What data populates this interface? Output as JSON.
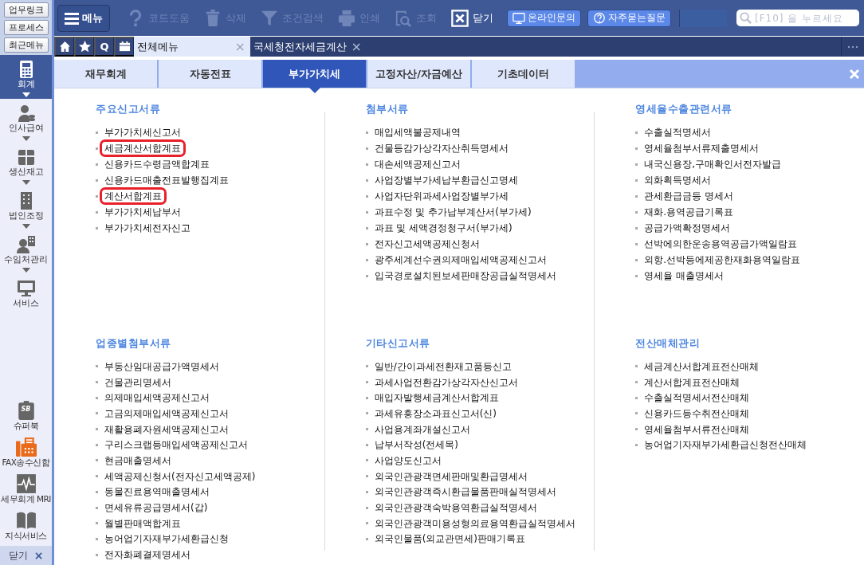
{
  "side_panel": {
    "quick_buttons": [
      "업무링크",
      "프로세스",
      "최근메뉴"
    ],
    "modules": [
      {
        "label": "회계",
        "selected": true,
        "caret": true
      },
      {
        "label": "인사급여",
        "selected": false,
        "caret": true
      },
      {
        "label": "생산재고",
        "selected": false,
        "caret": true
      },
      {
        "label": "법인조정",
        "selected": false,
        "caret": true
      },
      {
        "label": "수임처관리",
        "selected": false,
        "caret": true
      },
      {
        "label": "서비스",
        "selected": false,
        "caret": false
      }
    ],
    "tools": [
      {
        "label": "슈퍼북",
        "badge": "SB",
        "kind": "book"
      },
      {
        "label": "FAX송수신함",
        "kind": "fax"
      },
      {
        "label": "세무회계 MRI",
        "kind": "mri"
      },
      {
        "label": "지식서비스",
        "kind": "open-book"
      }
    ],
    "close": {
      "label": "닫기",
      "glyph": "×"
    }
  },
  "toolbar": {
    "menu_button": "메뉴",
    "actions": [
      {
        "label": "코드도움",
        "disabled": true
      },
      {
        "label": "삭제",
        "disabled": true
      },
      {
        "label": "조건검색",
        "disabled": true
      },
      {
        "label": "인쇄",
        "disabled": true
      },
      {
        "label": "조회",
        "disabled": true
      },
      {
        "label": "닫기",
        "disabled": false
      }
    ],
    "help_buttons": [
      "온라인문의",
      "자주묻는질문"
    ],
    "search": {
      "placeholder": "[F10] 을 누르세요"
    }
  },
  "window_tabs": {
    "shortcuts": [
      "Q"
    ],
    "items": [
      {
        "label": "전체메뉴",
        "selected": true,
        "close": "×"
      },
      {
        "label": "국세청전자세금계산",
        "selected": false,
        "close": "×"
      }
    ]
  },
  "categories": [
    {
      "label": "재무회계",
      "selected": false
    },
    {
      "label": "자동전표",
      "selected": false
    },
    {
      "label": "부가가치세",
      "selected": true
    },
    {
      "label": "고정자산/자금예산",
      "selected": false
    },
    {
      "label": "기초데이터",
      "selected": false
    }
  ],
  "sections": [
    {
      "title": "주요신고서류",
      "items": [
        {
          "label": "부가가치세신고서",
          "highlighted": false
        },
        {
          "label": "세금계산서합계표",
          "highlighted": true
        },
        {
          "label": "신용카드수령금액합계표",
          "highlighted": false
        },
        {
          "label": "신용카드매출전표발행집계표",
          "highlighted": false
        },
        {
          "label": "계산서합계표",
          "highlighted": true
        },
        {
          "label": "부가가치세납부서",
          "highlighted": false
        },
        {
          "label": "부가가치세전자신고",
          "highlighted": false
        }
      ]
    },
    {
      "title": "첨부서류",
      "items": [
        {
          "label": "매입세액불공제내역",
          "highlighted": false
        },
        {
          "label": "건물등감가상각자산취득명세서",
          "highlighted": false
        },
        {
          "label": "대손세액공제신고서",
          "highlighted": false
        },
        {
          "label": "사업장별부가세납부환급신고명세",
          "highlighted": false
        },
        {
          "label": "사업자단위과세사업장별부가세",
          "highlighted": false
        },
        {
          "label": "과표수정 및 추가납부계산서(부가세)",
          "highlighted": false
        },
        {
          "label": "과표 및 세액경정청구서(부가세)",
          "highlighted": false
        },
        {
          "label": "전자신고세액공제신청서",
          "highlighted": false
        },
        {
          "label": "광주세계선수권의제매입세액공제신고서",
          "highlighted": false
        },
        {
          "label": "입국경로설치된보세판매장공급실적명세서",
          "highlighted": false
        }
      ]
    },
    {
      "title": "영세율수출관련서류",
      "items": [
        {
          "label": "수출실적명세서",
          "highlighted": false
        },
        {
          "label": "영세율첨부서류제출명세서",
          "highlighted": false
        },
        {
          "label": "내국신용장,구매확인서전자발급",
          "highlighted": false
        },
        {
          "label": "외화획득명세서",
          "highlighted": false
        },
        {
          "label": "관세환급금등 명세서",
          "highlighted": false
        },
        {
          "label": "재화.용역공급기록표",
          "highlighted": false
        },
        {
          "label": "공급가액확정명세서",
          "highlighted": false
        },
        {
          "label": "선박에의한운송용역공급가액일람표",
          "highlighted": false
        },
        {
          "label": "외항.선박등에제공한재화용역일람표",
          "highlighted": false
        },
        {
          "label": "영세율 매출명세서",
          "highlighted": false
        }
      ]
    },
    {
      "title": "업종별첨부서류",
      "items": [
        {
          "label": "부동산임대공급가액명세서",
          "highlighted": false
        },
        {
          "label": "건물관리명세서",
          "highlighted": false
        },
        {
          "label": "의제매입세액공제신고서",
          "highlighted": false
        },
        {
          "label": "고금의제매입세액공제신고서",
          "highlighted": false
        },
        {
          "label": "재활용폐자원세액공제신고서",
          "highlighted": false
        },
        {
          "label": "구리스크랩등매입세액공제신고서",
          "highlighted": false
        },
        {
          "label": "현금매출명세서",
          "highlighted": false
        },
        {
          "label": "세액공제신청서(전자신고세액공제)",
          "highlighted": false
        },
        {
          "label": "동물진료용역매출명세서",
          "highlighted": false
        },
        {
          "label": "면세유류공급명세서(갑)",
          "highlighted": false
        },
        {
          "label": "월별판매액합계표",
          "highlighted": false
        },
        {
          "label": "농어업기자재부가세환급신청",
          "highlighted": false
        },
        {
          "label": "전자화폐결제명세서",
          "highlighted": false
        }
      ]
    },
    {
      "title": "기타신고서류",
      "items": [
        {
          "label": "일반/간이과세전환재고품등신고",
          "highlighted": false
        },
        {
          "label": "과세사업전환감가상각자산신고서",
          "highlighted": false
        },
        {
          "label": "매입자발행세금계산서합계표",
          "highlighted": false
        },
        {
          "label": "과세유흥장소과표신고서(신)",
          "highlighted": false
        },
        {
          "label": "사업용계좌개설신고서",
          "highlighted": false
        },
        {
          "label": "납부서작성(전세목)",
          "highlighted": false
        },
        {
          "label": "사업양도신고서",
          "highlighted": false
        },
        {
          "label": "외국인관광객면세판매및환급명세서",
          "highlighted": false
        },
        {
          "label": "외국인관광객즉시환급물품판매실적명세서",
          "highlighted": false
        },
        {
          "label": "외국인관광객숙박용역환급실적명세서",
          "highlighted": false
        },
        {
          "label": "외국인관광객미용성형의료용역환급실적명세서",
          "highlighted": false
        },
        {
          "label": "외국인물품(외교관면세)판매기록표",
          "highlighted": false
        }
      ]
    },
    {
      "title": "전산매체관리",
      "items": [
        {
          "label": "세금계산서합계표전산매체",
          "highlighted": false
        },
        {
          "label": "계산서합계표전산매체",
          "highlighted": false
        },
        {
          "label": "수출실적명세서전산매체",
          "highlighted": false
        },
        {
          "label": "신용카드등수취전산매체",
          "highlighted": false
        },
        {
          "label": "영세율첨부서류전산매체",
          "highlighted": false
        },
        {
          "label": "농어업기자재부가세환급신청전산매체",
          "highlighted": false
        }
      ]
    }
  ]
}
